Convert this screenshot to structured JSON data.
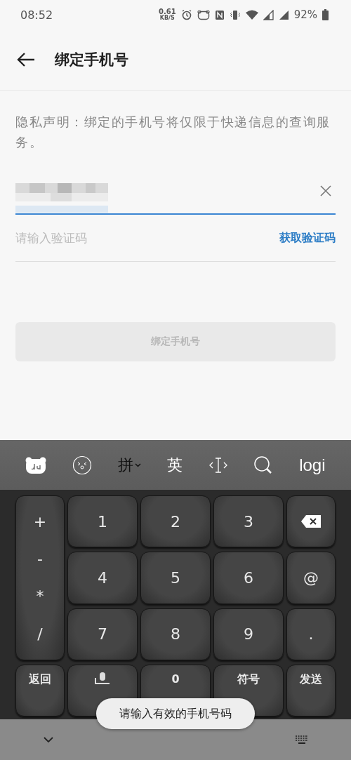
{
  "status_bar": {
    "time": "08:52",
    "net_speed": "0.61",
    "net_unit": "KB/S",
    "battery": "92%"
  },
  "header": {
    "title": "绑定手机号"
  },
  "privacy_notice": "隐私声明：绑定的手机号将仅限于快递信息的查询服务。",
  "phone_field": {
    "focused": true
  },
  "code_field": {
    "placeholder": "请输入验证码",
    "action": "获取验证码"
  },
  "submit_button": {
    "label": "绑定手机号",
    "disabled": true
  },
  "keyboard": {
    "toolbar": [
      {
        "kind": "du"
      },
      {
        "kind": "emoji"
      },
      {
        "kind": "text",
        "label": "拼",
        "dropdown": true
      },
      {
        "kind": "text",
        "label": "英",
        "dropdown": false
      },
      {
        "kind": "cursor"
      },
      {
        "kind": "search"
      },
      {
        "kind": "logo",
        "label": "logi"
      }
    ],
    "symbols": [
      "+",
      "-",
      "*",
      "/"
    ],
    "digits": [
      "1",
      "2",
      "3",
      "4",
      "5",
      "6",
      "7",
      "8",
      "9"
    ],
    "right_keys": [
      {
        "kind": "backspace"
      },
      {
        "kind": "text",
        "label": "@"
      },
      {
        "kind": "text",
        "label": "."
      }
    ],
    "bottom_row": [
      {
        "kind": "text",
        "label": "返回"
      },
      {
        "kind": "mic"
      },
      {
        "kind": "text",
        "label": "0"
      },
      {
        "kind": "text",
        "label": "符号"
      },
      {
        "kind": "text",
        "label": "发送"
      }
    ]
  },
  "toast": "请输入有效的手机号码"
}
